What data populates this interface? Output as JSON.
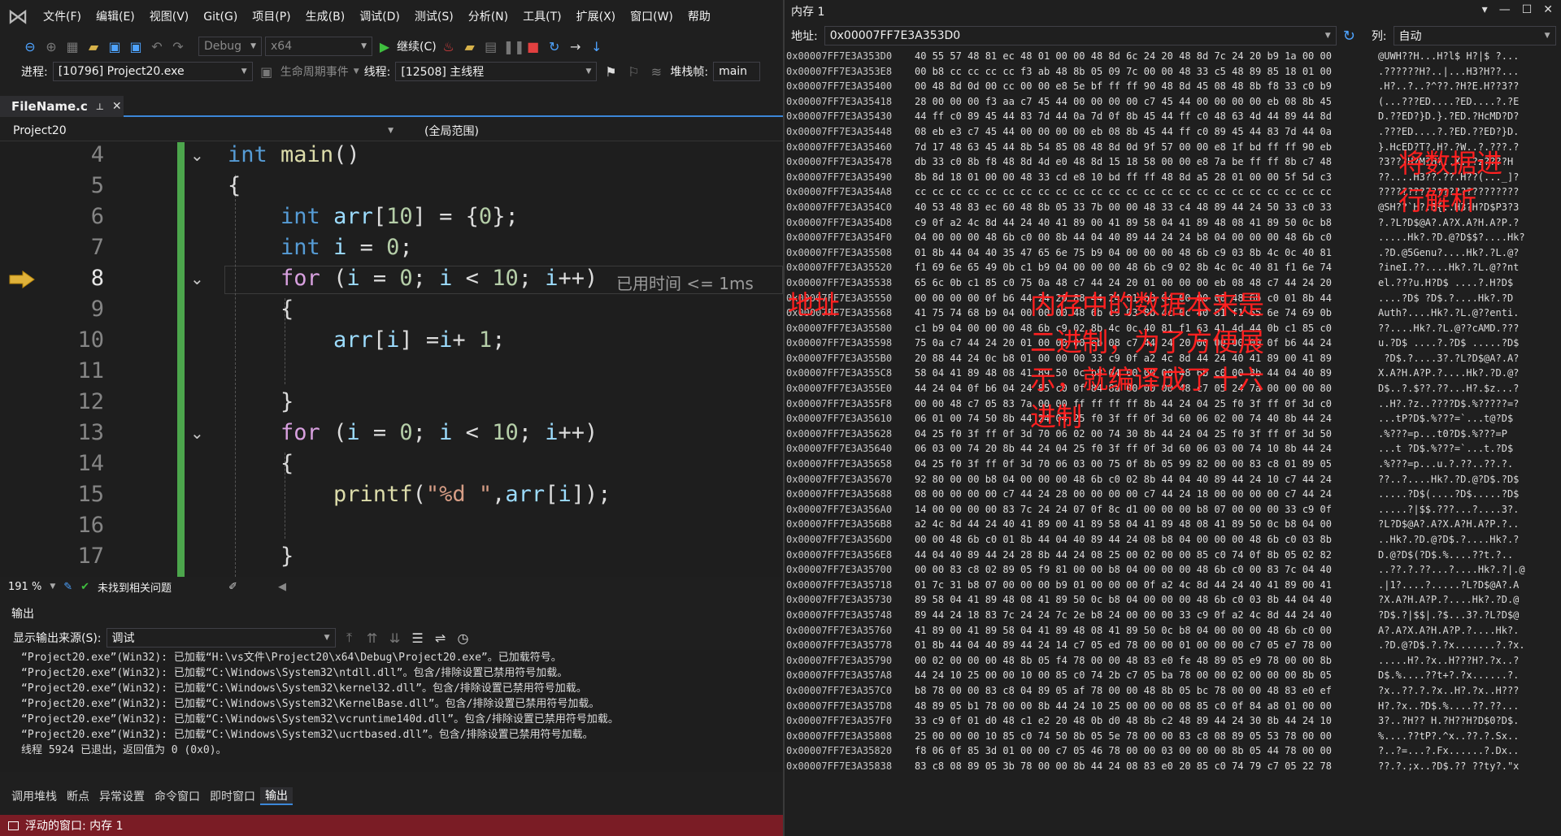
{
  "menu": {
    "items": [
      "文件(F)",
      "编辑(E)",
      "视图(V)",
      "Git(G)",
      "项目(P)",
      "生成(B)",
      "调试(D)",
      "测试(S)",
      "分析(N)",
      "工具(T)",
      "扩展(X)",
      "窗口(W)",
      "帮助"
    ]
  },
  "toolbar": {
    "config": "Debug",
    "platform": "x64",
    "continue_label": "继续(C)"
  },
  "debugbar": {
    "process_label": "进程:",
    "process_value": "[10796] Project20.exe",
    "lifecycle_label": "生命周期事件",
    "thread_label": "线程:",
    "thread_value": "[12508] 主线程",
    "stackframe_label": "堆栈帧:",
    "stackframe_value": "main"
  },
  "editor": {
    "file_tab": "FileName.c",
    "project_combo": "Project20",
    "scope_combo": "(全局范围)",
    "line_numbers": [
      "4",
      "5",
      "6",
      "7",
      "8",
      "9",
      "10",
      "11",
      "12",
      "13",
      "14",
      "15",
      "16",
      "17"
    ],
    "elapsed": "已用时间 <= 1ms",
    "zoom": "191 %",
    "issues": "未找到相关问题"
  },
  "output": {
    "header": "输出",
    "source_label": "显示输出来源(S):",
    "source_value": "调试",
    "lines": [
      "“Project20.exe”(Win32): 已加载“H:\\vs文件\\Project20\\x64\\Debug\\Project20.exe”。已加载符号。",
      "“Project20.exe”(Win32): 已加载“C:\\Windows\\System32\\ntdll.dll”。包含/排除设置已禁用符号加载。",
      "“Project20.exe”(Win32): 已加载“C:\\Windows\\System32\\kernel32.dll”。包含/排除设置已禁用符号加载。",
      "“Project20.exe”(Win32): 已加载“C:\\Windows\\System32\\KernelBase.dll”。包含/排除设置已禁用符号加载。",
      "“Project20.exe”(Win32): 已加载“C:\\Windows\\System32\\vcruntime140d.dll”。包含/排除设置已禁用符号加载。",
      "“Project20.exe”(Win32): 已加载“C:\\Windows\\System32\\ucrtbased.dll”。包含/排除设置已禁用符号加载。",
      "线程 5924 已退出，返回值为 0 (0x0)。"
    ]
  },
  "bottom_tabs": [
    "调用堆栈",
    "断点",
    "异常设置",
    "命令窗口",
    "即时窗口",
    "输出"
  ],
  "status_bar": "浮动的窗口: 内存 1",
  "memory": {
    "title": "内存 1",
    "address_label": "地址:",
    "address_value": "0x00007FF7E3A353D0",
    "columns_label": "列:",
    "columns_value": "自动",
    "rows": [
      [
        "0x00007FF7E3A353D0",
        "40 55 57 48 81 ec 48 01 00 00 48 8d 6c 24 20 48 8d 7c 24 20 b9 1a 00 00",
        "@UWH??H...H?l$ H?|$ ?..."
      ],
      [
        "0x00007FF7E3A353E8",
        "00 b8 cc cc cc cc f3 ab 48 8b 05 09 7c 00 00 48 33 c5 48 89 85 18 01 00",
        ".??????H?..|...H3?H??..."
      ],
      [
        "0x00007FF7E3A35400",
        "00 48 8d 0d 00 cc 00 00 e8 5e bf ff ff 90 48 8d 45 08 48 8b f8 33 c0 b9",
        ".H?..?..?^??.?H?E.H??3??"
      ],
      [
        "0x00007FF7E3A35418",
        "28 00 00 00 f3 aa c7 45 44 00 00 00 00 c7 45 44 00 00 00 00 eb 08 8b 45",
        "(...???ED....?ED....?.?E"
      ],
      [
        "0x00007FF7E3A35430",
        "44 ff c0 89 45 44 83 7d 44 0a 7d 0f 8b 45 44 ff c0 48 63 4d 44 89 44 8d",
        "D.??ED?}D.}.?ED.?HcMD?D?"
      ],
      [
        "0x00007FF7E3A35448",
        "08 eb e3 c7 45 44 00 00 00 00 eb 08 8b 45 44 ff c0 89 45 44 83 7d 44 0a",
        ".???ED....?.?ED.??ED?}D."
      ],
      [
        "0x00007FF7E3A35460",
        "7d 17 48 63 45 44 8b 54 85 08 48 8d 0d 9f 57 00 00 e8 1f bd ff ff 90 eb",
        "}.HcED?T?.H?.?W..?.???.?"
      ],
      [
        "0x00007FF7E3A35478",
        "db 33 c0 8b f8 48 8d 4d e0 48 8d 15 18 58 00 00 e8 7a be ff ff 8b c7 48",
        "?3???H?M?H?..X..?z????H"
      ],
      [
        "0x00007FF7E3A35490",
        "8b 8d 18 01 00 00 48 33 cd e8 10 bd ff ff 48 8d a5 28 01 00 00 5f 5d c3",
        "??....H3??.??.H??(..._]?"
      ],
      [
        "0x00007FF7E3A354A8",
        "cc cc cc cc cc cc cc cc cc cc cc cc cc cc cc cc cc cc cc cc cc cc cc cc",
        "????????????????????????"
      ],
      [
        "0x00007FF7E3A354C0",
        "40 53 48 83 ec 60 48 8b 05 33 7b 00 00 48 33 c4 48 89 44 24 50 33 c0 33",
        "@SH??`H?.3{..H3?H?D$P3?3"
      ],
      [
        "0x00007FF7E3A354D8",
        "c9 0f a2 4c 8d 44 24 40 41 89 00 41 89 58 04 41 89 48 08 41 89 50 0c b8",
        "?.?L?D$@A?.A?X.A?H.A?P.?"
      ],
      [
        "0x00007FF7E3A354F0",
        "04 00 00 00 48 6b c0 00 8b 44 04 40 89 44 24 24 b8 04 00 00 00 48 6b c0",
        ".....Hk?.?D.@?D$$?....Hk?"
      ],
      [
        "0x00007FF7E3A35508",
        "01 8b 44 04 40 35 47 65 6e 75 b9 04 00 00 00 48 6b c9 03 8b 4c 0c 40 81",
        ".?D.@5Genu?....Hk?.?L.@?"
      ],
      [
        "0x00007FF7E3A35520",
        "f1 69 6e 65 49 0b c1 b9 04 00 00 00 48 6b c9 02 8b 4c 0c 40 81 f1 6e 74",
        "?ineI.??....Hk?.?L.@??nt"
      ],
      [
        "0x00007FF7E3A35538",
        "65 6c 0b c1 85 c0 75 0a 48 c7 44 24 20 01 00 00 00 eb 08 48 c7 44 24 20",
        "el.???u.H?D$ ....?.H?D$ "
      ],
      [
        "0x00007FF7E3A35550",
        "00 00 00 00 0f b6 44 24 20 88 44 24 01 b8 04 00 00 00 48 6b c0 01 8b 44",
        "....?D$ ?D$.?....Hk?.?D"
      ],
      [
        "0x00007FF7E3A35568",
        "41 75 74 68 b9 04 00 00 00 48 6b c9 03 8b 4c 0c 40 81 f1 65 6e 74 69 0b",
        "Auth?....Hk?.?L.@??enti."
      ],
      [
        "0x00007FF7E3A35580",
        "c1 b9 04 00 00 00 48 6b c9 02 8b 4c 0c 40 81 f1 63 41 4d 44 0b c1 85 c0",
        "??....Hk?.?L.@??cAMD.???"
      ],
      [
        "0x00007FF7E3A35598",
        "75 0a c7 44 24 20 01 00 00 00 eb 08 c7 44 24 20 00 00 00 00 0f b6 44 24",
        "u.?D$ ....?.?D$ .....?D$"
      ],
      [
        "0x00007FF7E3A355B0",
        "20 88 44 24 0c b8 01 00 00 00 33 c9 0f a2 4c 8d 44 24 40 41 89 00 41 89",
        " ?D$.?....3?.?L?D$@A?.A?"
      ],
      [
        "0x00007FF7E3A355C8",
        "58 04 41 89 48 08 41 89 50 0c b8 04 00 00 00 48 6b c0 00 8b 44 04 40 89",
        "X.A?H.A?P.?....Hk?.?D.@?"
      ],
      [
        "0x00007FF7E3A355E0",
        "44 24 04 0f b6 04 24 85 c0 0f 84 8a 00 00 00 48 c7 05 24 7a 00 00 00 80",
        "D$..?.$??.??...H?.$z...?"
      ],
      [
        "0x00007FF7E3A355F8",
        "00 00 48 c7 05 83 7a 00 00 ff ff ff ff 8b 44 24 04 25 f0 3f ff 0f 3d c0",
        "..H?.?z..????D$.%?????=?"
      ],
      [
        "0x00007FF7E3A35610",
        "06 01 00 74 50 8b 44 24 04 25 f0 3f ff 0f 3d 60 06 02 00 74 40 8b 44 24",
        "...tP?D$.%???=`...t@?D$"
      ],
      [
        "0x00007FF7E3A35628",
        "04 25 f0 3f ff 0f 3d 70 06 02 00 74 30 8b 44 24 04 25 f0 3f ff 0f 3d 50",
        ".%???=p...t0?D$.%???=P"
      ],
      [
        "0x00007FF7E3A35640",
        "06 03 00 74 20 8b 44 24 04 25 f0 3f ff 0f 3d 60 06 03 00 74 10 8b 44 24",
        "...t ?D$.%???=`...t.?D$"
      ],
      [
        "0x00007FF7E3A35658",
        "04 25 f0 3f ff 0f 3d 70 06 03 00 75 0f 8b 05 99 82 00 00 83 c8 01 89 05",
        ".%???=p...u.?.??..??.?."
      ],
      [
        "0x00007FF7E3A35670",
        "92 80 00 00 b8 04 00 00 00 48 6b c0 02 8b 44 04 40 89 44 24 10 c7 44 24",
        "??..?....Hk?.?D.@?D$.?D$"
      ],
      [
        "0x00007FF7E3A35688",
        "08 00 00 00 00 c7 44 24 28 00 00 00 00 c7 44 24 18 00 00 00 00 c7 44 24",
        ".....?D$(....?D$.....?D$"
      ],
      [
        "0x00007FF7E3A356A0",
        "14 00 00 00 00 83 7c 24 24 07 0f 8c d1 00 00 00 b8 07 00 00 00 33 c9 0f",
        ".....?|$$.???...?....3?."
      ],
      [
        "0x00007FF7E3A356B8",
        "a2 4c 8d 44 24 40 41 89 00 41 89 58 04 41 89 48 08 41 89 50 0c b8 04 00",
        "?L?D$@A?.A?X.A?H.A?P.?.."
      ],
      [
        "0x00007FF7E3A356D0",
        "00 00 48 6b c0 01 8b 44 04 40 89 44 24 08 b8 04 00 00 00 48 6b c0 03 8b",
        "..Hk?.?D.@?D$.?....Hk?.?"
      ],
      [
        "0x00007FF7E3A356E8",
        "44 04 40 89 44 24 28 8b 44 24 08 25 00 02 00 00 85 c0 74 0f 8b 05 02 82",
        "D.@?D$(?D$.%....??t.?.."
      ],
      [
        "0x00007FF7E3A35700",
        "00 00 83 c8 02 89 05 f9 81 00 00 b8 04 00 00 00 48 6b c0 00 83 7c 04 40",
        "..??.?.??...?....Hk?.?|.@"
      ],
      [
        "0x00007FF7E3A35718",
        "01 7c 31 b8 07 00 00 00 b9 01 00 00 00 0f a2 4c 8d 44 24 40 41 89 00 41",
        ".|1?....?.....?L?D$@A?.A"
      ],
      [
        "0x00007FF7E3A35730",
        "89 58 04 41 89 48 08 41 89 50 0c b8 04 00 00 00 48 6b c0 03 8b 44 04 40",
        "?X.A?H.A?P.?....Hk?.?D.@"
      ],
      [
        "0x00007FF7E3A35748",
        "89 44 24 18 83 7c 24 24 7c 2e b8 24 00 00 00 33 c9 0f a2 4c 8d 44 24 40",
        "?D$.?|$$|.?$...3?.?L?D$@"
      ],
      [
        "0x00007FF7E3A35760",
        "41 89 00 41 89 58 04 41 89 48 08 41 89 50 0c b8 04 00 00 00 48 6b c0 00",
        "A?.A?X.A?H.A?P.?....Hk?."
      ],
      [
        "0x00007FF7E3A35778",
        "01 8b 44 04 40 89 44 24 14 c7 05 ed 78 00 00 01 00 00 00 c7 05 e7 78 00",
        ".?D.@?D$.?.?x.......?.?x."
      ],
      [
        "0x00007FF7E3A35790",
        "00 02 00 00 00 48 8b 05 f4 78 00 00 48 83 e0 fe 48 89 05 e9 78 00 00 8b",
        ".....H?.?x..H???H?.?x..?"
      ],
      [
        "0x00007FF7E3A357A8",
        "44 24 10 25 00 00 10 00 85 c0 74 2b c7 05 ba 78 00 00 02 00 00 00 8b 05",
        "D$.%....??t+?.?x......?."
      ],
      [
        "0x00007FF7E3A357C0",
        "b8 78 00 00 83 c8 04 89 05 af 78 00 00 48 8b 05 bc 78 00 00 48 83 e0 ef",
        "?x..??.?.?x..H?.?x..H???"
      ],
      [
        "0x00007FF7E3A357D8",
        "48 89 05 b1 78 00 00 8b 44 24 10 25 00 00 00 08 85 c0 0f 84 a8 01 00 00",
        "H?.?x..?D$.%....??.??..."
      ],
      [
        "0x00007FF7E3A357F0",
        "33 c9 0f 01 d0 48 c1 e2 20 48 0b d0 48 8b c2 48 89 44 24 30 8b 44 24 10",
        "3?..?H?? H.?H??H?D$0?D$."
      ],
      [
        "0x00007FF7E3A35808",
        "25 00 00 00 10 85 c0 74 50 8b 05 5e 78 00 00 83 c8 08 89 05 53 78 00 00",
        "%....??tP?.^x..??.?.Sx.."
      ],
      [
        "0x00007FF7E3A35820",
        "f8 06 0f 85 3d 01 00 00 c7 05 46 78 00 00 03 00 00 00 8b 05 44 78 00 00",
        "?..?=...?.Fx......?.Dx.."
      ],
      [
        "0x00007FF7E3A35838",
        "83 c8 08 89 05 3b 78 00 00 8b 44 24 08 83 e0 20 85 c0 74 79 c7 05 22 78",
        "??.?.;x..?D$.?? ??ty?.\"x"
      ]
    ]
  },
  "annotations": {
    "top": "将数据进\n行解析",
    "addr": "地址",
    "body": "内存中的数据本来是\n二进制，为了方便展\n示，就编译成了十六\n进制"
  },
  "colors": {
    "accent": "#3c87d8",
    "annotation": "#ff2020",
    "changed_bar": "#4ca64c",
    "status_bar": "#7a1c25"
  }
}
